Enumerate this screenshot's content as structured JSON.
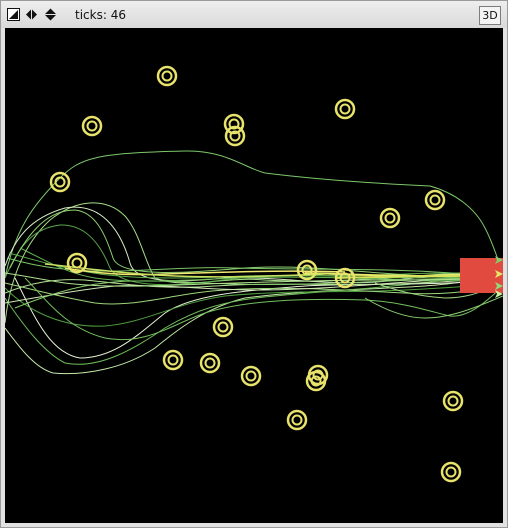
{
  "toolbar": {
    "icons": [
      "edit-icon",
      "step-icon",
      "speed-icon"
    ],
    "ticks_label": "ticks: 46",
    "view_3d_label": "3D"
  },
  "colors": {
    "view_bg": "#000000",
    "target": "#e8e36a",
    "goal": "#e04a3f",
    "trail_palette": [
      "#8fdc7a",
      "#6fbf5a",
      "#c8f0a0",
      "#4e9a3c",
      "#dff0c8",
      "#a0d080"
    ]
  }
}
